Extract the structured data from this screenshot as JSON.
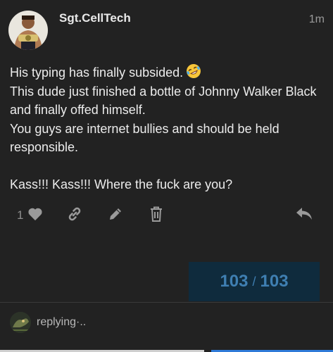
{
  "post": {
    "username": "Sgt.CellTech",
    "time": "1m",
    "lines": [
      "His typing has finally subsided.",
      "This dude just finished a bottle of Johnny Walker Black and finally offed himself.",
      "You guys are internet bullies and should be held responsible."
    ],
    "line2": "Kass!!! Kass!!! Where the fuck are you?",
    "emoji": "rofl-emoji",
    "like_count": "1"
  },
  "actions": {
    "icons": [
      "heart-icon",
      "link-icon",
      "edit-icon",
      "trash-icon",
      "reply-icon"
    ]
  },
  "progress": {
    "current": "103",
    "separator": "/",
    "total": "103"
  },
  "reply": {
    "status": "replying·.."
  },
  "colors": {
    "background": "#222222",
    "progress_bg": "#0f2b3d",
    "progress_text": "#3f7fb2",
    "accent_bar": "#2f7ad8"
  }
}
